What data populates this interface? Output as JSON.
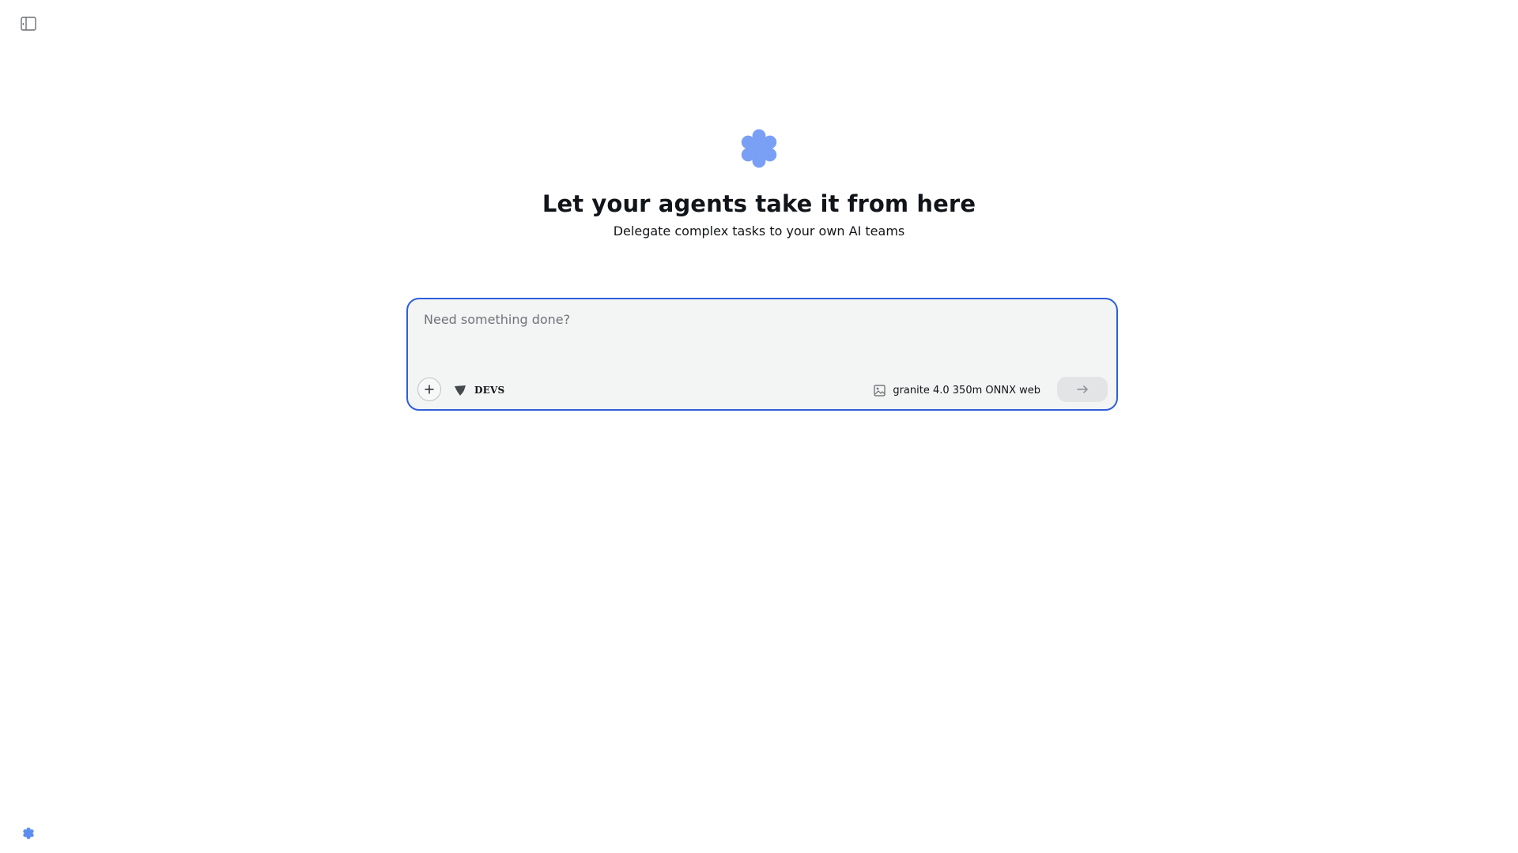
{
  "header": {
    "sidebar_toggle_icon": "sidebar-panel-icon"
  },
  "hero": {
    "logo_icon": "flower-star-icon",
    "logo_color": "#7aa0f5",
    "title": "Let your agents take it from here",
    "subtitle": "Delegate complex tasks to your own AI teams"
  },
  "prompt": {
    "placeholder": "Need something done?",
    "value": "",
    "focus_border_color": "#2e5fd9",
    "add_icon": "plus-icon",
    "team": {
      "icon": "shield-icon",
      "label": "DEVS"
    },
    "model": {
      "icon": "image-icon",
      "label": "granite 4.0 350m ONNX web"
    },
    "send_icon": "arrow-right-icon",
    "send_enabled": false
  },
  "footer": {
    "logo_icon": "flower-star-icon",
    "logo_color": "#5b8ef0"
  }
}
